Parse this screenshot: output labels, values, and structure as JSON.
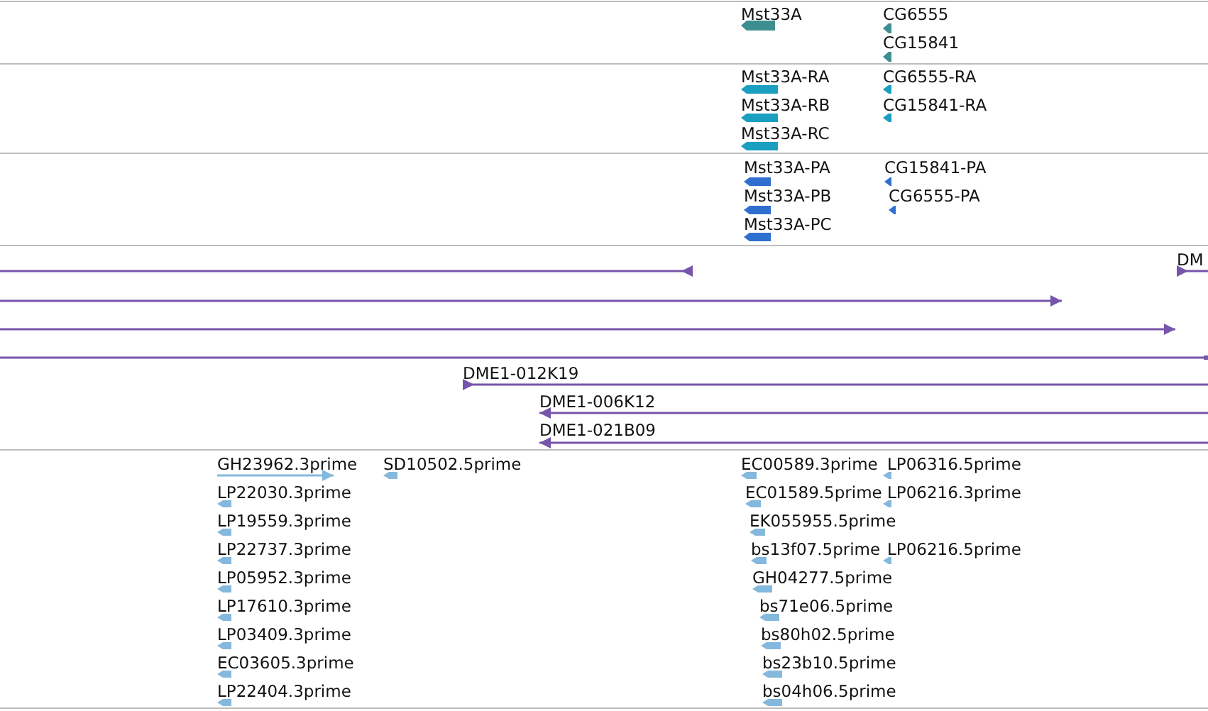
{
  "tracks": [
    {
      "kind": "gene",
      "color": "#3d8f8f",
      "features": [
        {
          "label": "Mst33A",
          "reverse": true
        },
        {
          "label": "CG6555",
          "reverse": true
        },
        {
          "label": "CG15841",
          "reverse": true
        }
      ]
    },
    {
      "kind": "transcript",
      "color": "#1a9fc0",
      "features": [
        {
          "label": "Mst33A-RA",
          "reverse": true
        },
        {
          "label": "Mst33A-RB",
          "reverse": true
        },
        {
          "label": "Mst33A-RC",
          "reverse": true
        },
        {
          "label": "CG6555-RA",
          "reverse": true
        },
        {
          "label": "CG15841-RA",
          "reverse": true
        }
      ]
    },
    {
      "kind": "protein",
      "color": "#2f6fcf",
      "features": [
        {
          "label": "Mst33A-PA",
          "reverse": true
        },
        {
          "label": "Mst33A-PB",
          "reverse": true
        },
        {
          "label": "Mst33A-PC",
          "reverse": true
        },
        {
          "label": "CG15841-PA",
          "reverse": true
        },
        {
          "label": "CG6555-PA",
          "reverse": true
        }
      ]
    },
    {
      "kind": "clone",
      "color": "#7755aa",
      "features": [
        {
          "reverse": true,
          "arrow": true
        },
        {
          "reverse": false,
          "arrow": true
        },
        {
          "reverse": false,
          "arrow": true
        },
        {
          "label": "DM",
          "reverse": false,
          "arrow": true
        },
        {
          "arrow": false
        },
        {
          "label": "DME1-012K19",
          "reverse": false,
          "arrow": true
        },
        {
          "label": "DME1-006K12",
          "reverse": true,
          "arrow": true
        },
        {
          "label": "DME1-021B09",
          "reverse": true,
          "arrow": true
        }
      ]
    },
    {
      "kind": "est",
      "color": "#84b9dd",
      "features": [
        {
          "label": "GH23962.3prime",
          "reverse": false
        },
        {
          "label": "LP22030.3prime",
          "reverse": true
        },
        {
          "label": "LP19559.3prime",
          "reverse": true
        },
        {
          "label": "LP22737.3prime",
          "reverse": true
        },
        {
          "label": "LP05952.3prime",
          "reverse": true
        },
        {
          "label": "LP17610.3prime",
          "reverse": true
        },
        {
          "label": "LP03409.3prime",
          "reverse": true
        },
        {
          "label": "EC03605.3prime",
          "reverse": true
        },
        {
          "label": "LP22404.3prime",
          "reverse": true
        },
        {
          "label": "SD10502.5prime",
          "reverse": true
        },
        {
          "label": "EC00589.3prime",
          "reverse": true
        },
        {
          "label": "EC01589.5prime",
          "reverse": true
        },
        {
          "label": "EK055955.5prime",
          "reverse": true
        },
        {
          "label": "bs13f07.5prime",
          "reverse": true
        },
        {
          "label": "GH04277.5prime",
          "reverse": true
        },
        {
          "label": "bs71e06.5prime",
          "reverse": true
        },
        {
          "label": "bs80h02.5prime",
          "reverse": true
        },
        {
          "label": "bs23b10.5prime",
          "reverse": true
        },
        {
          "label": "bs04h06.5prime",
          "reverse": true
        },
        {
          "label": "LP06316.5prime",
          "reverse": true
        },
        {
          "label": "LP06216.3prime",
          "reverse": true
        },
        {
          "label": "LP06216.5prime",
          "reverse": true
        }
      ]
    }
  ]
}
